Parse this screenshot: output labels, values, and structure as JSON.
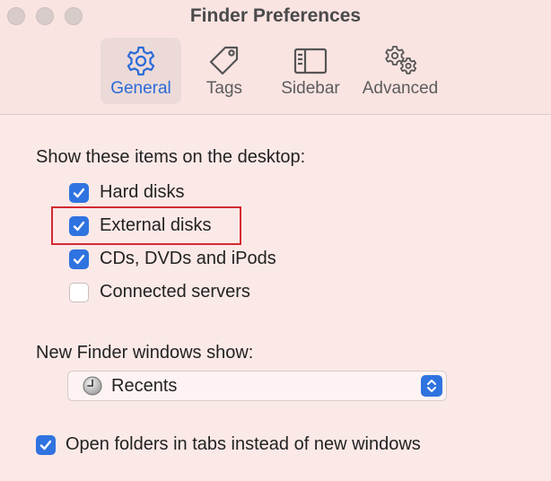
{
  "window": {
    "title": "Finder Preferences"
  },
  "toolbar": {
    "tabs": [
      {
        "label": "General",
        "icon": "gear-icon",
        "selected": true
      },
      {
        "label": "Tags",
        "icon": "tag-icon",
        "selected": false
      },
      {
        "label": "Sidebar",
        "icon": "sidebar-icon",
        "selected": false
      },
      {
        "label": "Advanced",
        "icon": "gears-icon",
        "selected": false
      }
    ]
  },
  "desktop": {
    "heading": "Show these items on the desktop:",
    "items": [
      {
        "label": "Hard disks",
        "checked": true
      },
      {
        "label": "External disks",
        "checked": true,
        "highlighted": true
      },
      {
        "label": "CDs, DVDs and iPods",
        "checked": true
      },
      {
        "label": "Connected servers",
        "checked": false
      }
    ]
  },
  "new_window": {
    "heading": "New Finder windows show:",
    "selected": "Recents",
    "icon": "clock-icon"
  },
  "tabs_option": {
    "label": "Open folders in tabs instead of new windows",
    "checked": true
  },
  "colors": {
    "accent": "#2f73e0",
    "background": "#fbe9e7",
    "highlight_border": "#d42a32"
  }
}
